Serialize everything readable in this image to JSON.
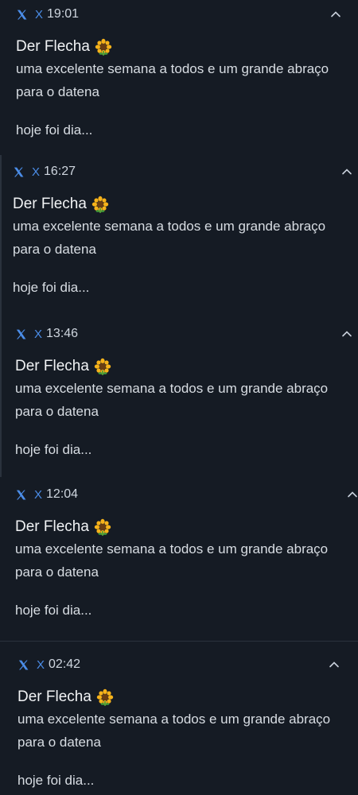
{
  "notifications": [
    {
      "app_name": "X",
      "time": "19:01",
      "title": "Der Flecha",
      "body": "uma excelente semana a todos e um grande abraço para o datena",
      "preview": "hoje foi dia..."
    },
    {
      "app_name": "X",
      "time": "16:27",
      "title": "Der Flecha",
      "body": "uma excelente semana a todos e um grande abraço para o datena",
      "preview": "hoje foi dia..."
    },
    {
      "app_name": "X",
      "time": "13:46",
      "title": "Der Flecha",
      "body": "uma excelente semana a todos e um grande abraço para o datena",
      "preview": "hoje foi dia..."
    },
    {
      "app_name": "X",
      "time": "12:04",
      "title": "Der Flecha",
      "body": "uma excelente semana a todos e um grande abraço para o datena",
      "preview": "hoje foi dia..."
    },
    {
      "app_name": "X",
      "time": "02:42",
      "title": "Der Flecha",
      "body": "uma excelente semana a todos e um grande abraço para o datena",
      "preview": "hoje foi dia..."
    }
  ],
  "icons": {
    "app": "x-logo-icon",
    "title_emoji": "sunflower-icon",
    "expand": "chevron-up-icon"
  },
  "colors": {
    "background": "#151b24",
    "accent": "#4b8de8",
    "title": "#f1f3f5",
    "text": "#d8dde3"
  }
}
